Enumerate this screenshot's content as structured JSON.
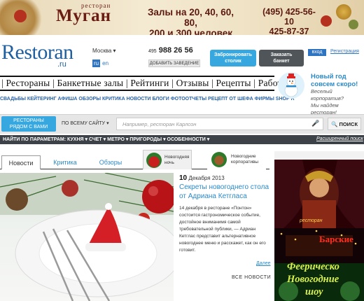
{
  "banner": {
    "brand_small": "ресторан",
    "brand": "Муган",
    "halls_line1": "Залы на 20, 40, 60, 80,",
    "halls_line2": "200 и 300 человек",
    "phone1": "(495) 425-56-10",
    "phone2": "425-87-37"
  },
  "header": {
    "logo": "Restoran",
    "logo_suffix": ".ru",
    "city": "Москва",
    "lang_ru": "ru",
    "lang_en": "en",
    "phone_prefix": "495",
    "phone": "988 26 56",
    "add_place": "ДОБАВИТЬ ЗАВЕДЕНИЕ",
    "book_table_l1": "Забронировать",
    "book_table_l2": "столик",
    "order_banquet_l1": "Заказать",
    "order_banquet_l2": "банкет",
    "login": "вход",
    "register": "Регистрация"
  },
  "main_nav": "| Рестораны | Банкетные залы | Рейтинги | Отзывы | Рецепты | Работа |",
  "sub_nav": "СВАДЬБЫ  КЕЙТЕРИНГ  АФИША  ОБЗОРЫ  КРИТИКА  НОВОСТИ  БЛОГИ  ФОТООТЧЕТЫ  РЕЦЕПТ ОТ ШЕФА  ФИРМЫ  SHOP R",
  "promo": {
    "title_l1": "Новый год",
    "title_l2": "совсем скоро!",
    "sub_l1": "Веселый корпоратив?",
    "sub_l2": "Мы найдем ресторан!"
  },
  "search": {
    "nearby_l1": "РЕСТОРАНЫ",
    "nearby_l2": "РЯДОМ С ВАМИ",
    "scope": "ПО ВСЕМУ САЙТУ ▾",
    "placeholder": "Например, ресторан Карлсон",
    "button": "ПОИСК"
  },
  "params": {
    "text": "НАЙТИ ПО ПАРАМЕТРАМ:    КУХНЯ ▾     СЧЕТ ▾     МЕТРО ▾     ПРИГОРОДЫ ▾     ОСОБЕННОСТИ ▾",
    "advanced": "Расширенный поиск"
  },
  "tabs": {
    "news": "Новости",
    "critic": "Критика",
    "reviews": "Обзоры",
    "ny_night_l1": "Новогодняя",
    "ny_night_l2": "ночь",
    "ny_corp_l1": "Новогодние",
    "ny_corp_l2": "корпоративы"
  },
  "article": {
    "day": "10",
    "month_year": "Декабря 2013",
    "title": "Секреты новогоднего стола от Адриана Кетгласа",
    "text": "14 декабря в ресторане «Понтон» состоится гастрономическое событие, достойное вниманимя самой требовательной публики, — Адриан Кетглас представит альтернативное новогоднее меню и расскажет, как он его готовит.",
    "more": "Далее",
    "all_news": "ВСЕ НОВОСТИ"
  },
  "ad": {
    "label": "ресторан",
    "bar": "Барские",
    "show_l1": "Феерическо",
    "show_l2": "Новогодние",
    "show_l3": "шоу"
  }
}
